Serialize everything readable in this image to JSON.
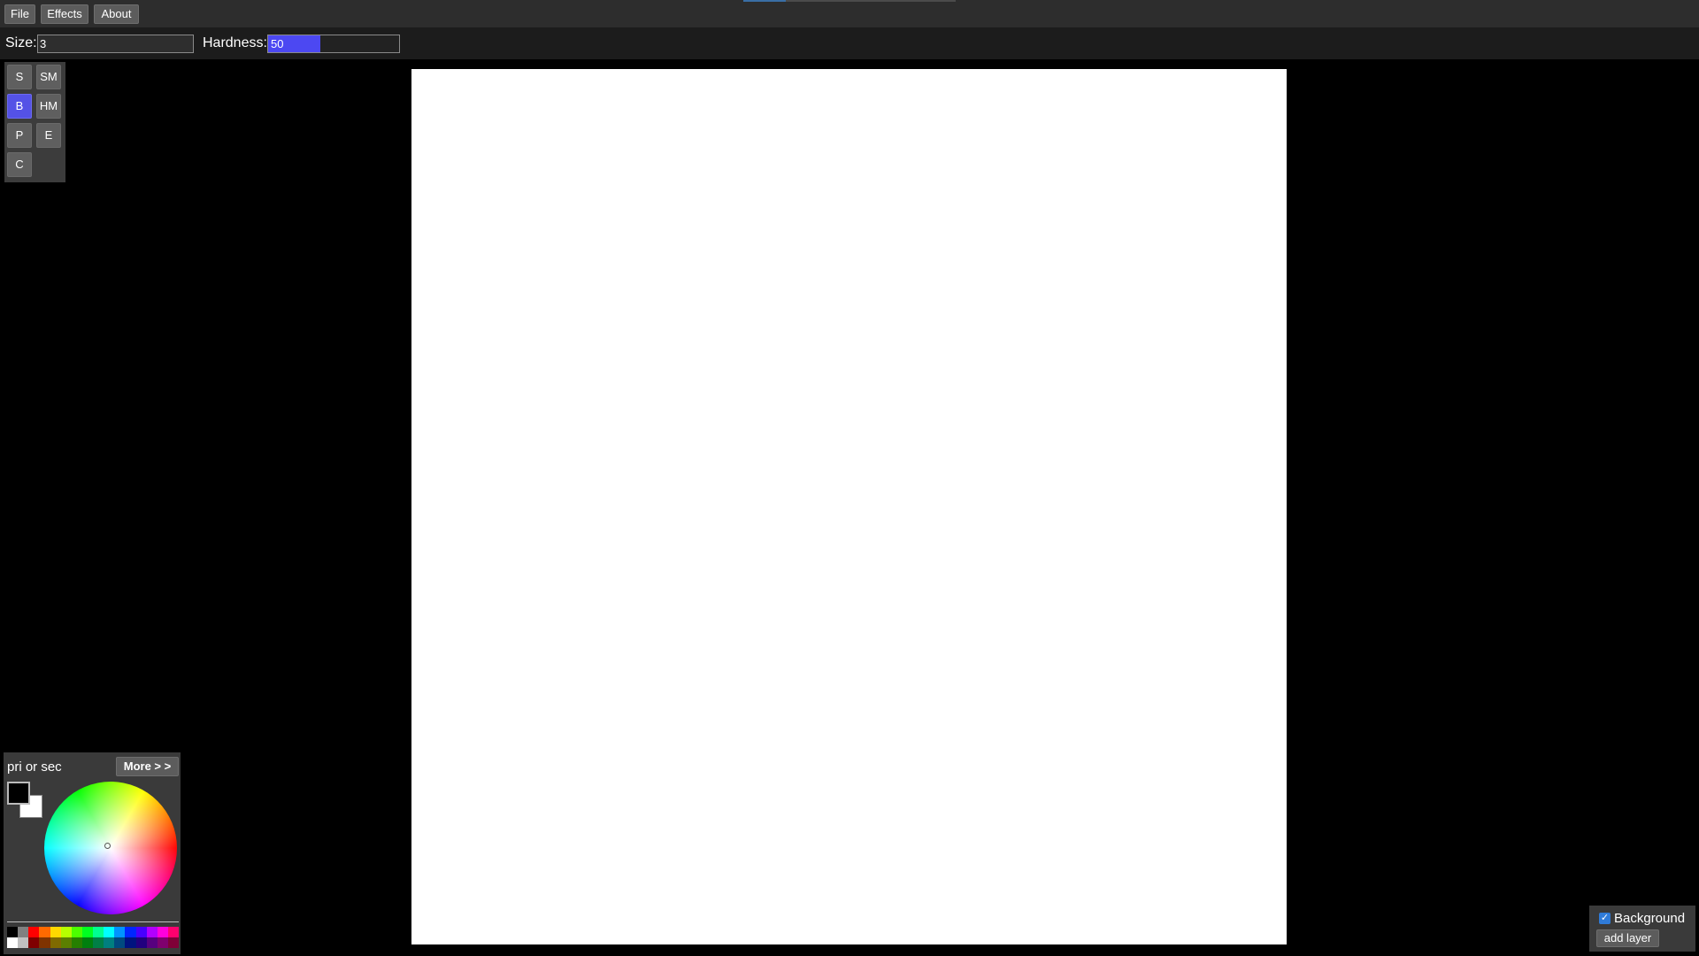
{
  "menu": {
    "file": "File",
    "effects": "Effects",
    "about": "About"
  },
  "options": {
    "size_label": "Size:",
    "size_value": "3",
    "hardness_label": "Hardness:",
    "hardness_value": "50",
    "hardness_fill_fraction": 0.4
  },
  "tools": {
    "s": "S",
    "sm": "SM",
    "b": "B",
    "hm": "HM",
    "p": "P",
    "e": "E",
    "c": "C",
    "active": "B"
  },
  "color_panel": {
    "title": "pri or sec",
    "more": "More > >",
    "primary_color": "#000000",
    "secondary_color": "#ffffff",
    "palette_top": [
      "#000000",
      "#808080",
      "#ff0000",
      "#ff6a00",
      "#ffd800",
      "#b6ff00",
      "#4cff00",
      "#00ff21",
      "#00ff90",
      "#00ffff",
      "#0094ff",
      "#0026ff",
      "#4800ff",
      "#b200ff",
      "#ff00dc",
      "#ff006e"
    ],
    "palette_bottom": [
      "#ffffff",
      "#c0c0c0",
      "#7f0000",
      "#7f3300",
      "#7f6a00",
      "#5b7f00",
      "#267f00",
      "#007f0e",
      "#007f46",
      "#007f7f",
      "#004a7f",
      "#00137f",
      "#21007f",
      "#57007f",
      "#7f006e",
      "#7f0037"
    ]
  },
  "layers": {
    "background_label": "Background",
    "background_checked": true,
    "add_layer": "add layer"
  },
  "colors": {
    "accent": "#4c48f2",
    "panel": "#3a3a3a",
    "button": "#5c5c5c"
  }
}
